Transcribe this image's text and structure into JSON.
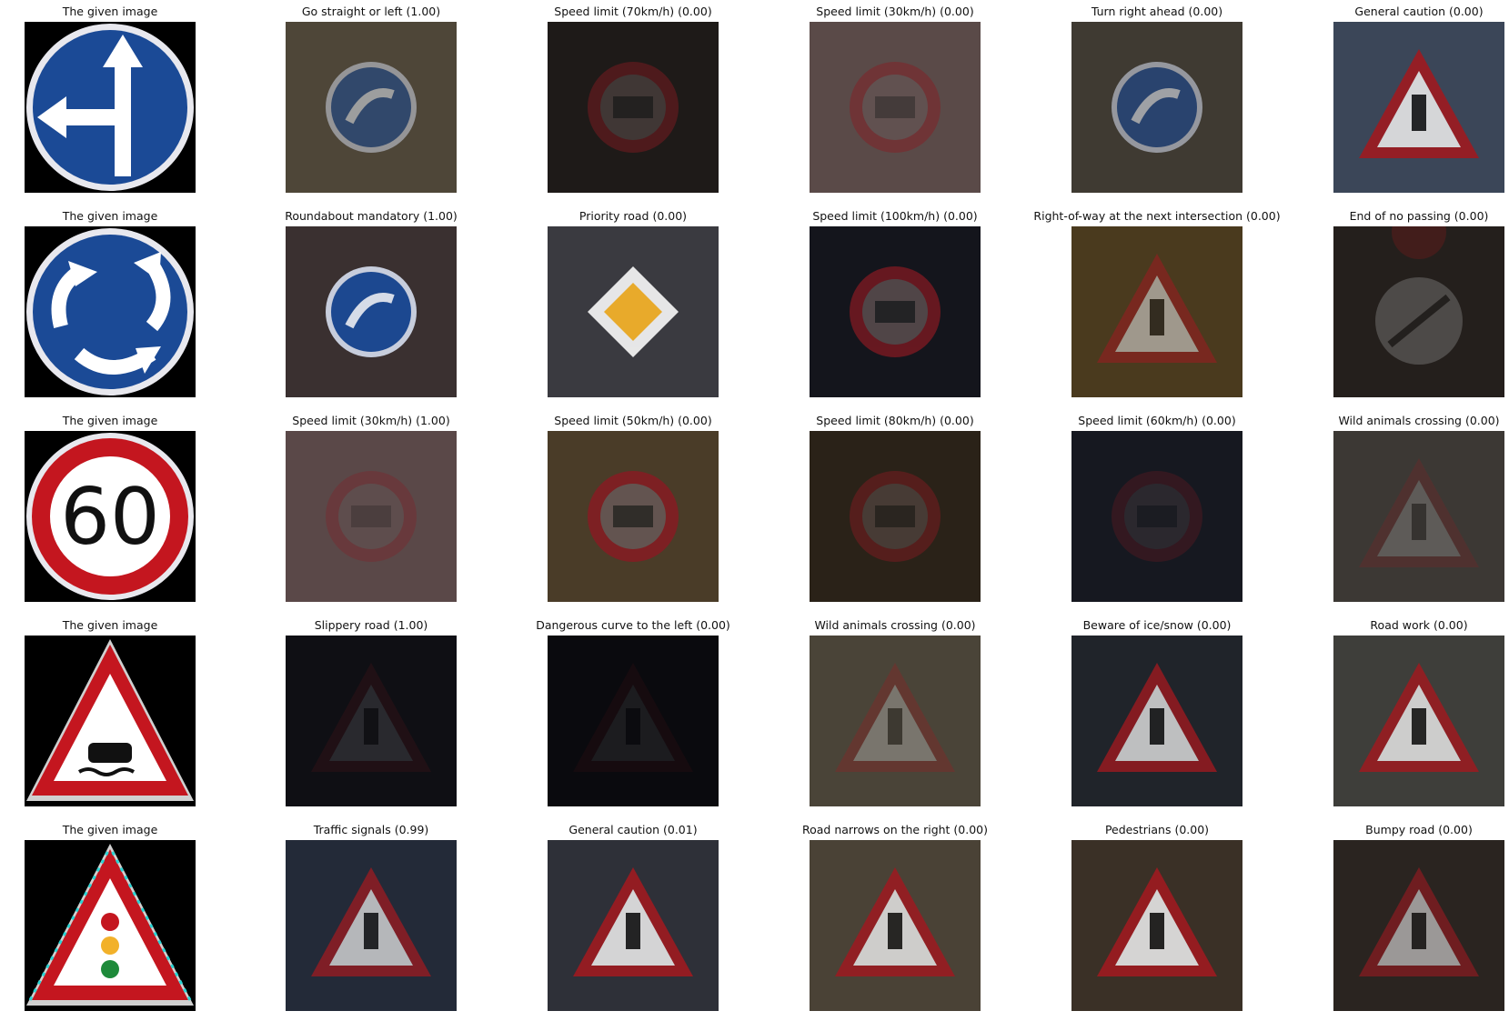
{
  "rows": [
    {
      "given": {
        "label": "The given image",
        "icon": "go-straight-or-left-sign-icon"
      },
      "predictions": [
        {
          "label": "Go straight or left (1.00)",
          "icon": "blue-circle-sign-icon"
        },
        {
          "label": "Speed limit (70km/h) (0.00)",
          "icon": "speed-limit-sign-icon"
        },
        {
          "label": "Speed limit (30km/h) (0.00)",
          "icon": "speed-limit-sign-icon"
        },
        {
          "label": "Turn right ahead (0.00)",
          "icon": "blue-circle-sign-icon"
        },
        {
          "label": "General caution (0.00)",
          "icon": "warning-triangle-sign-icon"
        }
      ]
    },
    {
      "given": {
        "label": "The given image",
        "icon": "roundabout-sign-icon"
      },
      "predictions": [
        {
          "label": "Roundabout mandatory (1.00)",
          "icon": "blue-circle-sign-icon"
        },
        {
          "label": "Priority road (0.00)",
          "icon": "priority-diamond-sign-icon"
        },
        {
          "label": "Speed limit (100km/h) (0.00)",
          "icon": "speed-limit-sign-icon"
        },
        {
          "label": "Right-of-way at the next intersection (0.00)",
          "icon": "warning-triangle-sign-icon"
        },
        {
          "label": "End of no passing (0.00)",
          "icon": "end-of-restriction-sign-icon"
        }
      ]
    },
    {
      "given": {
        "label": "The given image",
        "icon": "speed-limit-60-sign-icon",
        "text": "60"
      },
      "predictions": [
        {
          "label": "Speed limit (30km/h) (1.00)",
          "icon": "speed-limit-sign-icon"
        },
        {
          "label": "Speed limit (50km/h) (0.00)",
          "icon": "speed-limit-sign-icon"
        },
        {
          "label": "Speed limit (80km/h) (0.00)",
          "icon": "speed-limit-sign-icon"
        },
        {
          "label": "Speed limit (60km/h) (0.00)",
          "icon": "speed-limit-sign-icon"
        },
        {
          "label": "Wild animals crossing (0.00)",
          "icon": "warning-triangle-sign-icon"
        }
      ]
    },
    {
      "given": {
        "label": "The given image",
        "icon": "slippery-road-sign-icon"
      },
      "predictions": [
        {
          "label": "Slippery road (1.00)",
          "icon": "warning-triangle-sign-icon"
        },
        {
          "label": "Dangerous curve to the left (0.00)",
          "icon": "warning-triangle-sign-icon"
        },
        {
          "label": "Wild animals crossing (0.00)",
          "icon": "warning-triangle-sign-icon"
        },
        {
          "label": "Beware of ice/snow (0.00)",
          "icon": "warning-triangle-sign-icon"
        },
        {
          "label": "Road work (0.00)",
          "icon": "warning-triangle-sign-icon"
        }
      ]
    },
    {
      "given": {
        "label": "The given image",
        "icon": "traffic-signals-sign-icon"
      },
      "predictions": [
        {
          "label": "Traffic signals (0.99)",
          "icon": "warning-triangle-sign-icon"
        },
        {
          "label": "General caution (0.01)",
          "icon": "warning-triangle-sign-icon"
        },
        {
          "label": "Road narrows on the right (0.00)",
          "icon": "warning-triangle-sign-icon"
        },
        {
          "label": "Pedestrians (0.00)",
          "icon": "warning-triangle-sign-icon"
        },
        {
          "label": "Bumpy road (0.00)",
          "icon": "warning-triangle-sign-icon"
        }
      ]
    }
  ],
  "colors": {
    "sign_blue": "#1b4a96",
    "sign_red": "#c4161f",
    "sign_white": "#f5f5f5",
    "sign_yellow": "#f2b12a"
  }
}
